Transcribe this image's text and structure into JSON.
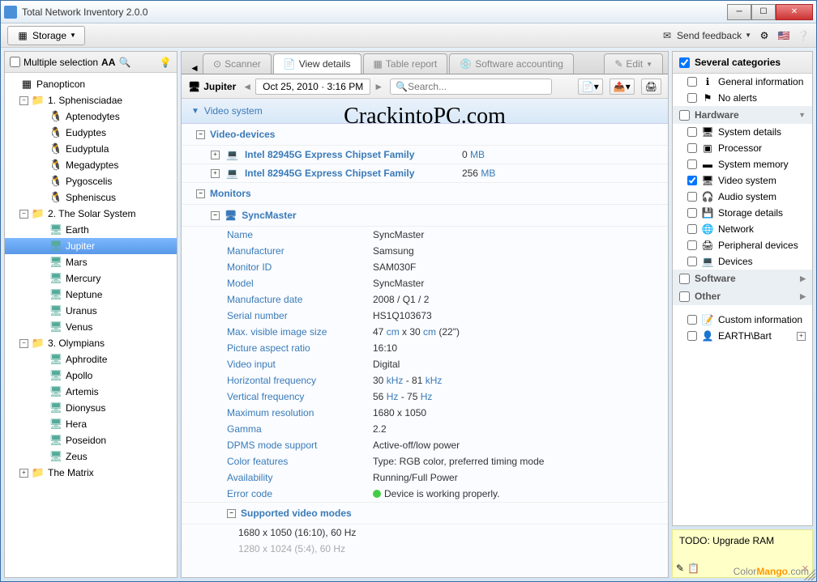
{
  "title": "Total Network Inventory 2.0.0",
  "toolbar": {
    "storage": "Storage",
    "feedback": "Send feedback"
  },
  "leftPanel": {
    "multiSelect": "Multiple selection",
    "aa": "AA"
  },
  "tree": {
    "root": "Panopticon",
    "g1": "1. Sphenisciadae",
    "g1items": [
      "Aptenodytes",
      "Eudyptes",
      "Eudyptula",
      "Megadyptes",
      "Pygoscelis",
      "Spheniscus"
    ],
    "g2": "2. The Solar System",
    "g2items": [
      "Earth",
      "Jupiter",
      "Mars",
      "Mercury",
      "Neptune",
      "Uranus",
      "Venus"
    ],
    "g3": "3. Olympians",
    "g3items": [
      "Aphrodite",
      "Apollo",
      "Artemis",
      "Dionysus",
      "Hera",
      "Poseidon",
      "Zeus"
    ],
    "g4": "The Matrix"
  },
  "tabs": {
    "scanner": "Scanner",
    "view": "View details",
    "table": "Table report",
    "software": "Software accounting",
    "edit": "Edit"
  },
  "subtool": {
    "host": "Jupiter",
    "date": "Oct 25, 2010 · 3:16 PM",
    "search": "Search..."
  },
  "overlay": "CrackintoPC.com",
  "section": {
    "title": "Video system",
    "videoDevices": "Video-devices",
    "dev1": {
      "name": "Intel 82945G Express Chipset Family",
      "mem": "0",
      "unit": "MB"
    },
    "dev2": {
      "name": "Intel 82945G Express Chipset Family",
      "mem": "256",
      "unit": "MB"
    },
    "monitors": "Monitors",
    "monName": "SyncMaster"
  },
  "props": [
    {
      "label": "Name",
      "value": "SyncMaster"
    },
    {
      "label": "Manufacturer",
      "value": "Samsung"
    },
    {
      "label": "Monitor ID",
      "value": "SAM030F"
    },
    {
      "label": "Model",
      "value": "SyncMaster"
    },
    {
      "label": "Manufacture date",
      "value": "2008 / Q1 / 2"
    },
    {
      "label": "Serial number",
      "value": "HS1Q103673"
    },
    {
      "label": "Max. visible image size",
      "value": "47 cm x 30 cm (22\")",
      "rich": "47 <u>cm</u> x 30 <u>cm</u> (22\")"
    },
    {
      "label": "Picture aspect ratio",
      "value": "16:10"
    },
    {
      "label": "Video input",
      "value": "Digital"
    },
    {
      "label": "Horizontal frequency",
      "value": "30 kHz - 81 kHz",
      "rich": "30 <u>kHz</u> - 81 <u>kHz</u>"
    },
    {
      "label": "Vertical frequency",
      "value": "56 Hz - 75 Hz",
      "rich": "56 <u>Hz</u> - 75 <u>Hz</u>"
    },
    {
      "label": "Maximum resolution",
      "value": "1680 x 1050"
    },
    {
      "label": "Gamma",
      "value": "2.2"
    },
    {
      "label": "DPMS mode support",
      "value": "Active-off/low power"
    },
    {
      "label": "Color features",
      "value": "Type: RGB color, preferred timing mode"
    },
    {
      "label": "Availability",
      "value": "Running/Full Power"
    },
    {
      "label": "Error code",
      "value": "Device is working properly.",
      "status": true
    }
  ],
  "modes": {
    "title": "Supported video modes",
    "m1": "1680 x 1050 (16:10), 60 Hz",
    "m2": "1280 x 1024 (5:4), 60 Hz"
  },
  "cats": {
    "head": "Several categories",
    "general": "General information",
    "noalerts": "No alerts",
    "hardware": "Hardware",
    "hw": [
      "System details",
      "Processor",
      "System memory",
      "Video system",
      "Audio system",
      "Storage details",
      "Network",
      "Peripheral devices",
      "Devices"
    ],
    "hwChecked": [
      false,
      false,
      false,
      true,
      false,
      false,
      false,
      false,
      false
    ],
    "software": "Software",
    "other": "Other",
    "custom": "Custom information",
    "user": "EARTH\\Bart"
  },
  "note": "TODO: Upgrade RAM",
  "wm1": "Color",
  "wm2": "Mango",
  "wm3": ".com"
}
